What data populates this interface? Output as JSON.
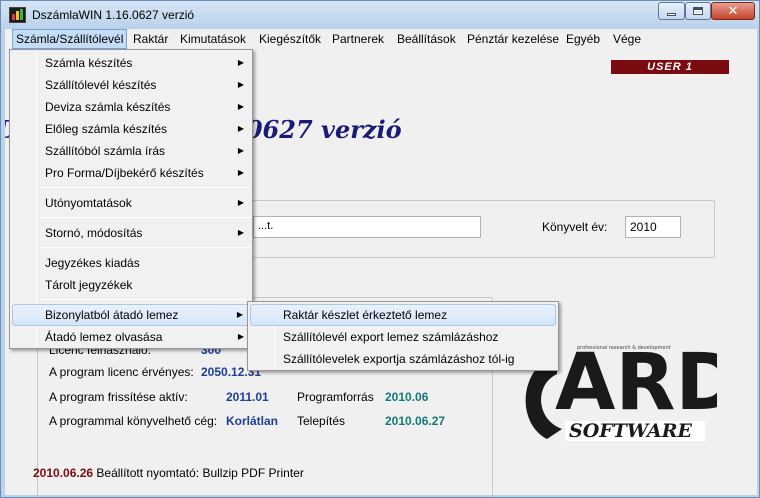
{
  "window": {
    "title": "DszámlaWIN 1.16.0627 verzió"
  },
  "menubar": {
    "items": [
      {
        "label": "Számla/Szállítólevél"
      },
      {
        "label": "Raktár"
      },
      {
        "label": "Kimutatások"
      },
      {
        "label": "Kiegészítők"
      },
      {
        "label": "Partnerek"
      },
      {
        "label": "Beállítások"
      },
      {
        "label": "Pénztár kezelése"
      },
      {
        "label": "Egyéb"
      },
      {
        "label": "Vége"
      }
    ]
  },
  "main": {
    "user_badge": "USER 1",
    "big_title": "DszámlaWIN 1.16.0627 verzió",
    "company_field_value": "...t.",
    "konyv_label": "Könyvelt év:",
    "konyv_year": "2010",
    "info": {
      "row0_label": "Licenc felhasználó:",
      "row0_value": "300",
      "licenc_label": "A program licenc érvényes:",
      "licenc_value": "2050.12.31",
      "frissites_label": "A program frissítése aktív:",
      "frissites_value": "2011.01",
      "programforras_label": "Programforrás",
      "programforras_value": "2010.06",
      "ceg_label": "A programmal könyvelhető cég:",
      "ceg_value": "Korlátlan",
      "telepites_label": "Telepítés",
      "telepites_value": "2010.06.27"
    },
    "logo": {
      "line1": "ARD",
      "line2": "SOFTWARE",
      "small": "professional research & development"
    },
    "status": {
      "date": "2010.06.26",
      "text": "Beállított nyomtató: Bullzip PDF Printer"
    }
  },
  "dropdown_main": {
    "items": [
      {
        "label": "Számla készítés",
        "submenu": true
      },
      {
        "label": "Szállítólevél készítés",
        "submenu": true
      },
      {
        "label": "Deviza számla készítés",
        "submenu": true
      },
      {
        "label": "Előleg számla készítés",
        "submenu": true
      },
      {
        "label": "Szállítóból számla írás",
        "submenu": true
      },
      {
        "label": "Pro Forma/Díjbekérő készítés",
        "submenu": true
      },
      {
        "label": "Utónyomtatások",
        "submenu": true
      },
      {
        "label": "Stornó, módosítás",
        "submenu": true
      },
      {
        "label": "Jegyzékes kiadás",
        "submenu": false
      },
      {
        "label": "Tárolt jegyzékek",
        "submenu": false
      },
      {
        "label": "Bizonylatból átadó lemez",
        "submenu": true
      },
      {
        "label": "Átadó lemez olvasása",
        "submenu": true
      }
    ]
  },
  "dropdown_sub": {
    "items": [
      {
        "label": "Raktár készlet érkeztető lemez"
      },
      {
        "label": "Szállítólevél export lemez számlázáshoz"
      },
      {
        "label": "Szállítólevelek exportja számlázáshoz tól-ig"
      }
    ]
  },
  "colors": {
    "accent_dark_red": "#7b0b10",
    "title_blue": "#1a1a78",
    "value_blue": "#1f3d99",
    "value_teal": "#137a77"
  }
}
